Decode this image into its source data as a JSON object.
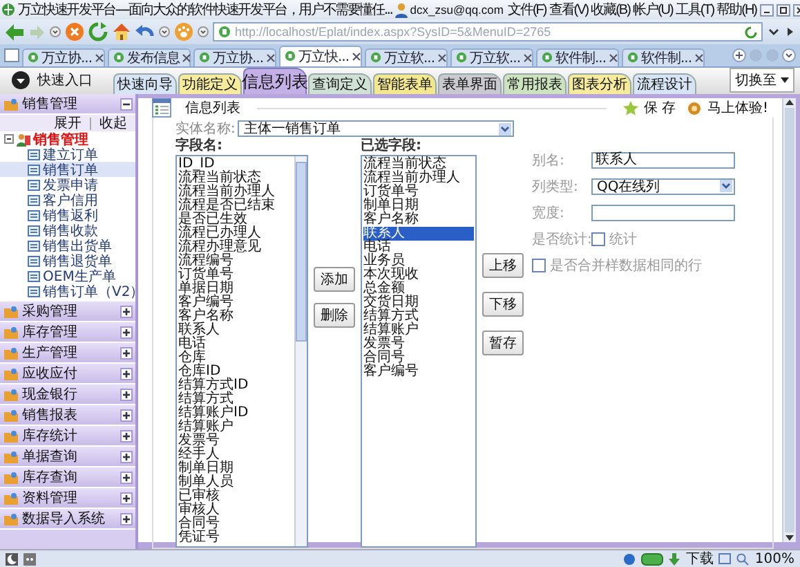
{
  "window": {
    "title": "万立快速开发平台----面向大众的软件快速开发平台，用户不需要懂任...",
    "account": "dcx_zsu@qq.com"
  },
  "menu": [
    "文件(F)",
    "查看(V)",
    "收藏(B)",
    "帐户(U)",
    "工具(T)",
    "帮助(H)"
  ],
  "address": {
    "url": "http://localhost/Eplat/index.aspx?SysID=5&MenuID=2765"
  },
  "browser_tabs": [
    {
      "label": "万立协...",
      "selected": false
    },
    {
      "label": "发布信息",
      "selected": false
    },
    {
      "label": "万立协...",
      "selected": false
    },
    {
      "label": "万立快...",
      "selected": true
    },
    {
      "label": "万立软...",
      "selected": false
    },
    {
      "label": "万立软...",
      "selected": false
    },
    {
      "label": "软件制...",
      "selected": false
    },
    {
      "label": "软件制...",
      "selected": false
    }
  ],
  "quick_entry": {
    "label": "快速入口"
  },
  "module_tabs": [
    {
      "label": "快速向导",
      "selected": false,
      "color": "#d6e4f5"
    },
    {
      "label": "功能定义",
      "selected": false,
      "color": "#f5eb9a"
    },
    {
      "label": "信息列表",
      "selected": true,
      "color": "#c2b0e6"
    },
    {
      "label": "查询定义",
      "selected": false,
      "color": "#cfe0d4"
    },
    {
      "label": "智能表单",
      "selected": false,
      "color": "#f3e88e"
    },
    {
      "label": "表单界面",
      "selected": false,
      "color": "#c9c9cf"
    },
    {
      "label": "常用报表",
      "selected": false,
      "color": "#cde3c0"
    },
    {
      "label": "图表分析",
      "selected": false,
      "color": "#f5eb9a"
    },
    {
      "label": "流程设计",
      "selected": false,
      "color": "#d6e4f5"
    }
  ],
  "switch": {
    "label": "切换至"
  },
  "sidebar": {
    "groups": [
      {
        "label": "销售管理",
        "expanded": true,
        "actions": [
          "展开",
          "收起"
        ],
        "tree": {
          "label": "销售管理",
          "children": [
            {
              "label": "建立订单",
              "selected": false
            },
            {
              "label": "销售订单",
              "selected": true
            },
            {
              "label": "发票申请",
              "selected": false
            },
            {
              "label": "客户信用",
              "selected": false
            },
            {
              "label": "销售返利",
              "selected": false
            },
            {
              "label": "销售收款",
              "selected": false
            },
            {
              "label": "销售出货单",
              "selected": false
            },
            {
              "label": "销售退货单",
              "selected": false
            },
            {
              "label": "OEM生产单",
              "selected": false
            },
            {
              "label": "销售订单（V2）",
              "selected": false
            }
          ]
        }
      },
      {
        "label": "采购管理",
        "expanded": false
      },
      {
        "label": "库存管理",
        "expanded": false
      },
      {
        "label": "生产管理",
        "expanded": false
      },
      {
        "label": "应收应付",
        "expanded": false
      },
      {
        "label": "现金银行",
        "expanded": false
      },
      {
        "label": "销售报表",
        "expanded": false
      },
      {
        "label": "库存统计",
        "expanded": false
      },
      {
        "label": "单据查询",
        "expanded": false
      },
      {
        "label": "库存查询",
        "expanded": false
      },
      {
        "label": "资料管理",
        "expanded": false
      },
      {
        "label": "数据导入系统",
        "expanded": false
      }
    ]
  },
  "toolbar": [
    "保 存",
    "马上体验!"
  ],
  "panel": {
    "title": "信息列表",
    "entity_label": "实体名称:",
    "entity_value": "主体一销售订单",
    "fields_label": "字段名:",
    "fields": [
      {
        "label": "ID_ID",
        "selected": false
      },
      {
        "label": "流程当前状态",
        "selected": false
      },
      {
        "label": "流程当前办理人",
        "selected": false
      },
      {
        "label": "流程是否已结束",
        "selected": false
      },
      {
        "label": "是否已生效",
        "selected": false
      },
      {
        "label": "流程已办理人",
        "selected": false
      },
      {
        "label": "流程办理意见",
        "selected": false
      },
      {
        "label": "流程编号",
        "selected": false
      },
      {
        "label": "订货单号",
        "selected": false
      },
      {
        "label": "单据日期",
        "selected": false
      },
      {
        "label": "客户编号",
        "selected": false
      },
      {
        "label": "客户名称",
        "selected": false
      },
      {
        "label": "联系人",
        "selected": false
      },
      {
        "label": "电话",
        "selected": false
      },
      {
        "label": "仓库",
        "selected": false
      },
      {
        "label": "仓库ID",
        "selected": false
      },
      {
        "label": "结算方式ID",
        "selected": false
      },
      {
        "label": "结算方式",
        "selected": false
      },
      {
        "label": "结算账户ID",
        "selected": false
      },
      {
        "label": "结算账户",
        "selected": false
      },
      {
        "label": "发票号",
        "selected": false
      },
      {
        "label": "经手人",
        "selected": false
      },
      {
        "label": "制单日期",
        "selected": false
      },
      {
        "label": "制单人员",
        "selected": false
      },
      {
        "label": "已审核",
        "selected": false
      },
      {
        "label": "审核人",
        "selected": false
      },
      {
        "label": "合同号",
        "selected": false
      },
      {
        "label": "凭证号",
        "selected": false
      }
    ],
    "selected_label": "已选字段:",
    "selected_fields": [
      {
        "label": "流程当前状态",
        "selected": false
      },
      {
        "label": "流程当前办理人",
        "selected": false
      },
      {
        "label": "订货单号",
        "selected": false
      },
      {
        "label": "制单日期",
        "selected": false
      },
      {
        "label": "客户名称",
        "selected": false
      },
      {
        "label": "联系人",
        "selected": true
      },
      {
        "label": "电话",
        "selected": false
      },
      {
        "label": "业务员",
        "selected": false
      },
      {
        "label": "本次现收",
        "selected": false
      },
      {
        "label": "总金额",
        "selected": false
      },
      {
        "label": "交货日期",
        "selected": false
      },
      {
        "label": "结算方式",
        "selected": false
      },
      {
        "label": "结算账户",
        "selected": false
      },
      {
        "label": "发票号",
        "selected": false
      },
      {
        "label": "合同号",
        "selected": false
      },
      {
        "label": "客户编号",
        "selected": false
      }
    ],
    "add_buttons": [
      "添加",
      "删除"
    ],
    "move_buttons": [
      "上移",
      "下移",
      "暂存"
    ],
    "form": {
      "alias_label": "别名:",
      "alias_value": "联系人",
      "type_label": "列类型:",
      "type_value": "QQ在线列",
      "width_label": "宽度:",
      "stat_label": "是否统计:",
      "stat_text": "统计",
      "stat_checked": false,
      "merge_text": "是否合并样数据相同的行",
      "merge_checked": false
    }
  },
  "status_bar": {
    "download": "下载",
    "zoom": "100%"
  }
}
